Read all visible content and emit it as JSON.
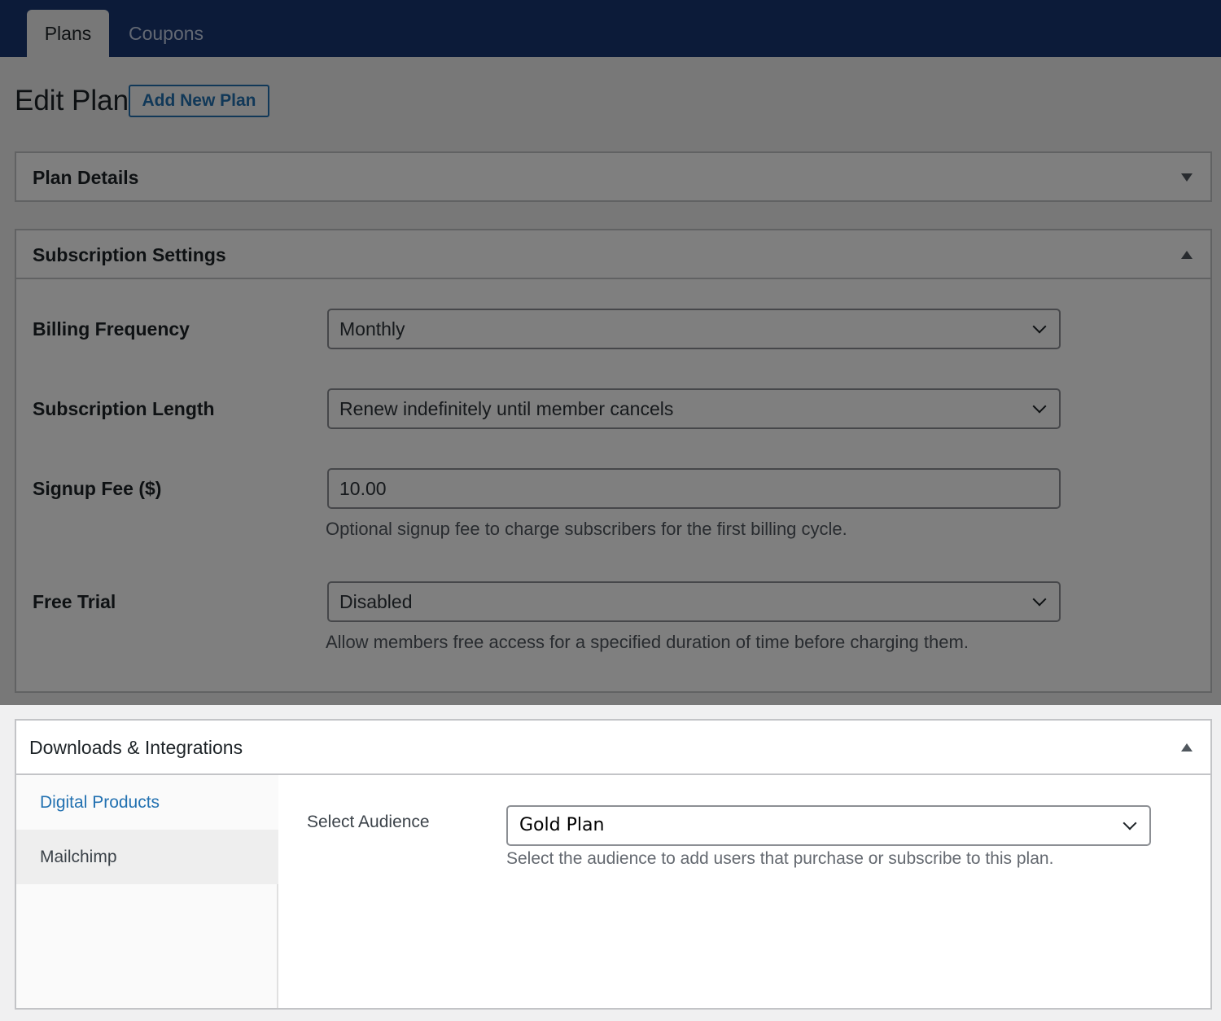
{
  "tabs": [
    {
      "label": "Plans",
      "active": true
    },
    {
      "label": "Coupons",
      "active": false
    }
  ],
  "page": {
    "title": "Edit Plan",
    "add_new_label": "Add New Plan"
  },
  "plan_details": {
    "title": "Plan Details",
    "toggle_icon": "arrow-down-icon"
  },
  "subscription": {
    "title": "Subscription Settings",
    "toggle_icon": "arrow-up-icon",
    "billing_frequency": {
      "label": "Billing Frequency",
      "value": "Monthly"
    },
    "subscription_length": {
      "label": "Subscription Length",
      "value": "Renew indefinitely until member cancels"
    },
    "signup_fee": {
      "label": "Signup Fee ($)",
      "value": "10.00",
      "help": "Optional signup fee to charge subscribers for the first billing cycle."
    },
    "free_trial": {
      "label": "Free Trial",
      "value": "Disabled",
      "help": "Allow members free access for a specified duration of time before charging them."
    }
  },
  "downloads": {
    "title": "Downloads & Integrations",
    "toggle_icon": "arrow-up-icon",
    "tabs": [
      {
        "label": "Digital Products",
        "active": false
      },
      {
        "label": "Mailchimp",
        "active": true
      }
    ],
    "audience": {
      "label": "Select Audience",
      "value": "Gold Plan",
      "help": "Select the audience to add users that purchase or subscribe to this plan."
    }
  },
  "colors": {
    "header_bg": "#183773",
    "link": "#2271b1",
    "overlay": "rgba(0,0,0,0.5)"
  }
}
